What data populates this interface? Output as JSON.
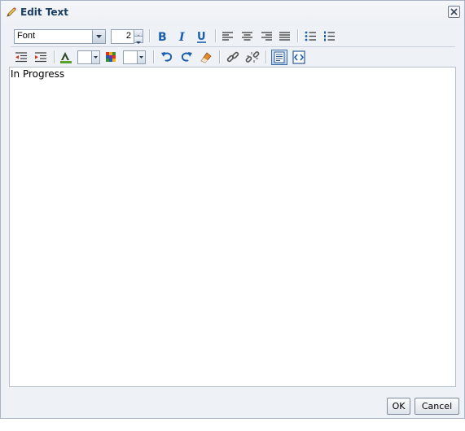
{
  "dialog": {
    "title": "Edit Text",
    "title_icon": "pencil-icon",
    "close_icon": "close-icon"
  },
  "toolbar": {
    "font_select": {
      "value": "Font"
    },
    "font_size": {
      "value": "2"
    },
    "row1_icons": [
      "bold-icon",
      "italic-icon",
      "underline-icon",
      "align-left-icon",
      "align-center-icon",
      "align-right-icon",
      "align-justify-icon",
      "bulleted-list-icon",
      "numbered-list-icon"
    ],
    "row2_icons": [
      "outdent-icon",
      "indent-icon",
      "text-color-icon",
      "background-color-icon",
      "undo-icon",
      "redo-icon",
      "clear-formatting-icon",
      "link-icon",
      "unlink-icon",
      "rich-text-mode-icon",
      "source-code-mode-icon"
    ],
    "bold_label": "B",
    "italic_label": "I",
    "underline_label": "U"
  },
  "editor": {
    "content": "In Progress"
  },
  "buttons": {
    "ok": "OK",
    "cancel": "Cancel"
  },
  "colors": {
    "accent": "#1a5fae",
    "title_text": "#1b3d63",
    "dialog_bg": "#eef1f5"
  }
}
